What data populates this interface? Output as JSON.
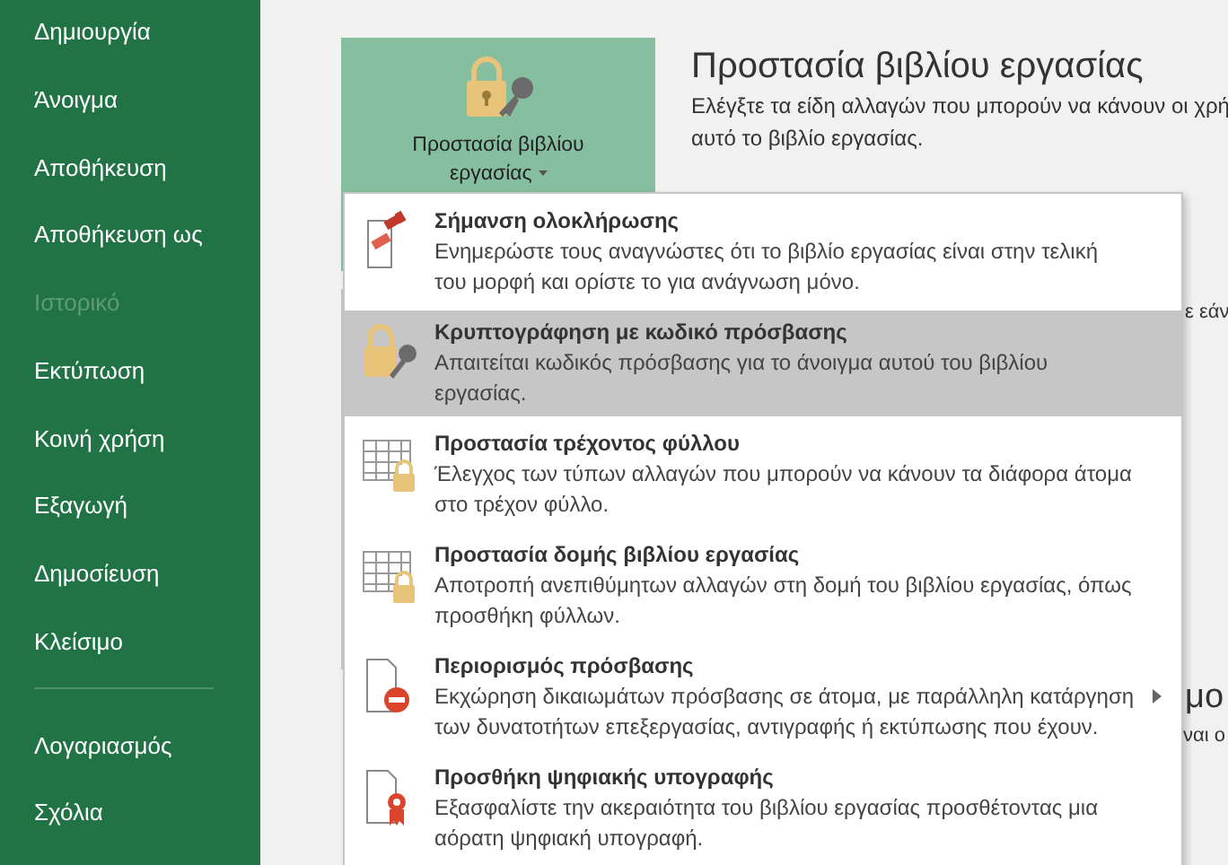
{
  "sidebar": {
    "items": [
      {
        "label": "Δημιουργία",
        "disabled": false
      },
      {
        "label": "Άνοιγμα",
        "disabled": false
      },
      {
        "label": "Αποθήκευση",
        "disabled": false
      },
      {
        "label": "Αποθήκευση ως",
        "disabled": false
      },
      {
        "label": "Ιστορικό",
        "disabled": true
      },
      {
        "label": "Εκτύπωση",
        "disabled": false
      },
      {
        "label": "Κοινή χρήση",
        "disabled": false
      },
      {
        "label": "Εξαγωγή",
        "disabled": false
      },
      {
        "label": "Δημοσίευση",
        "disabled": false
      },
      {
        "label": "Κλείσιμο",
        "disabled": false
      }
    ],
    "bottom_items": [
      {
        "label": "Λογαριασμός",
        "disabled": false
      },
      {
        "label": "Σχόλια",
        "disabled": false
      }
    ]
  },
  "protect_button": {
    "label_line_1": "Προστασία βιβλίου",
    "label_line_2": "εργασίας"
  },
  "section": {
    "title": "Προστασία βιβλίου εργασίας",
    "description": "Ελέγξτε τα είδη αλλαγών που μπορούν να κάνουν οι χρή",
    "description_line_2": "αυτό το βιβλίο εργασίας."
  },
  "background_fragments": [
    "ε εάν",
    "μο",
    "ναι ο"
  ],
  "menu": {
    "items": [
      {
        "kind": "stamp",
        "title": "Σήμανση ολοκλήρωσης",
        "description": "Ενημερώστε τους αναγνώστες ότι το βιβλίο εργασίας είναι στην τελική του μορφή και ορίστε το για ανάγνωση μόνο.",
        "selected": false,
        "submenu": false
      },
      {
        "kind": "lock",
        "title": "Κρυπτογράφηση με κωδικό πρόσβασης",
        "description": "Απαιτείται κωδικός πρόσβασης για το άνοιγμα αυτού του βιβλίου εργασίας.",
        "selected": true,
        "submenu": false
      },
      {
        "kind": "sheet",
        "title": "Προστασία τρέχοντος φύλλου",
        "description": "Έλεγχος των τύπων αλλαγών που μπορούν να κάνουν τα διάφορα άτομα στο τρέχον φύλλο.",
        "selected": false,
        "submenu": false
      },
      {
        "kind": "sheet",
        "title": "Προστασία δομής βιβλίου εργασίας",
        "description": "Αποτροπή ανεπιθύμητων αλλαγών στη δομή του βιβλίου εργασίας, όπως προσθήκη φύλλων.",
        "selected": false,
        "submenu": false
      },
      {
        "kind": "restrict",
        "title": "Περιορισμός πρόσβασης",
        "description": "Εκχώρηση δικαιωμάτων πρόσβασης σε άτομα, με παράλληλη κατάργηση των δυνατοτήτων επεξεργασίας, αντιγραφής ή εκτύπωσης που έχουν.",
        "selected": false,
        "submenu": true
      },
      {
        "kind": "signature",
        "title": "Προσθήκη ψηφιακής υπογραφής",
        "description": "Εξασφαλίστε την ακεραιότητα του βιβλίου εργασίας προσθέτοντας μια αόρατη ψηφιακή υπογραφή.",
        "selected": false,
        "submenu": false
      }
    ]
  }
}
